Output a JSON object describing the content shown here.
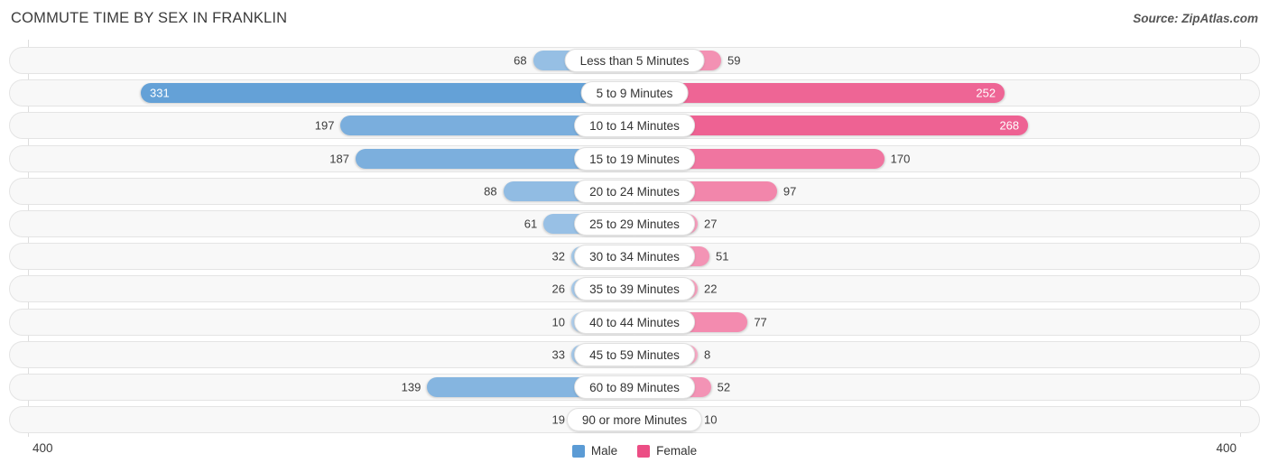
{
  "header": {
    "title": "COMMUTE TIME BY SEX IN FRANKLIN",
    "source": "Source: ZipAtlas.com"
  },
  "axis": {
    "left_tick": "400",
    "right_tick": "400",
    "max": 400
  },
  "legend": {
    "items": [
      {
        "label": "Male",
        "color": "#5b9bd5"
      },
      {
        "label": "Female",
        "color": "#ec4e85"
      }
    ]
  },
  "colors": {
    "male": "#5b9bd5",
    "female": "#ec4e85",
    "track": "#f8f8f8",
    "track_border": "#e4e4e4"
  },
  "chart_data": {
    "type": "bar",
    "orientation": "horizontal-diverging",
    "title": "COMMUTE TIME BY SEX IN FRANKLIN",
    "xlabel": "",
    "ylabel": "",
    "xlim": [
      400,
      400
    ],
    "grid": false,
    "legend_position": "bottom-center",
    "categories": [
      "Less than 5 Minutes",
      "5 to 9 Minutes",
      "10 to 14 Minutes",
      "15 to 19 Minutes",
      "20 to 24 Minutes",
      "25 to 29 Minutes",
      "30 to 34 Minutes",
      "35 to 39 Minutes",
      "40 to 44 Minutes",
      "45 to 59 Minutes",
      "60 to 89 Minutes",
      "90 or more Minutes"
    ],
    "series": [
      {
        "name": "Male",
        "values": [
          68,
          331,
          197,
          187,
          88,
          61,
          32,
          26,
          10,
          33,
          139,
          19
        ]
      },
      {
        "name": "Female",
        "values": [
          59,
          252,
          268,
          170,
          97,
          27,
          51,
          22,
          77,
          8,
          52,
          10
        ]
      }
    ]
  },
  "rows": [
    {
      "category": "Less than 5 Minutes",
      "male": 68,
      "female": 59,
      "male_label": "68",
      "female_label": "59",
      "male_inside": false,
      "female_inside": false
    },
    {
      "category": "5 to 9 Minutes",
      "male": 331,
      "female": 252,
      "male_label": "331",
      "female_label": "252",
      "male_inside": true,
      "female_inside": true
    },
    {
      "category": "10 to 14 Minutes",
      "male": 197,
      "female": 268,
      "male_label": "197",
      "female_label": "268",
      "male_inside": false,
      "female_inside": true
    },
    {
      "category": "15 to 19 Minutes",
      "male": 187,
      "female": 170,
      "male_label": "187",
      "female_label": "170",
      "male_inside": false,
      "female_inside": false
    },
    {
      "category": "20 to 24 Minutes",
      "male": 88,
      "female": 97,
      "male_label": "88",
      "female_label": "97",
      "male_inside": false,
      "female_inside": false
    },
    {
      "category": "25 to 29 Minutes",
      "male": 61,
      "female": 27,
      "male_label": "61",
      "female_label": "27",
      "male_inside": false,
      "female_inside": false
    },
    {
      "category": "30 to 34 Minutes",
      "male": 32,
      "female": 51,
      "male_label": "32",
      "female_label": "51",
      "male_inside": false,
      "female_inside": false
    },
    {
      "category": "35 to 39 Minutes",
      "male": 26,
      "female": 22,
      "male_label": "26",
      "female_label": "22",
      "male_inside": false,
      "female_inside": false
    },
    {
      "category": "40 to 44 Minutes",
      "male": 10,
      "female": 77,
      "male_label": "10",
      "female_label": "77",
      "male_inside": false,
      "female_inside": false
    },
    {
      "category": "45 to 59 Minutes",
      "male": 33,
      "female": 8,
      "male_label": "33",
      "female_label": "8",
      "male_inside": false,
      "female_inside": false
    },
    {
      "category": "60 to 89 Minutes",
      "male": 139,
      "female": 52,
      "male_label": "139",
      "female_label": "52",
      "male_inside": false,
      "female_inside": false
    },
    {
      "category": "90 or more Minutes",
      "male": 19,
      "female": 10,
      "male_label": "19",
      "female_label": "10",
      "male_inside": false,
      "female_inside": false
    }
  ]
}
